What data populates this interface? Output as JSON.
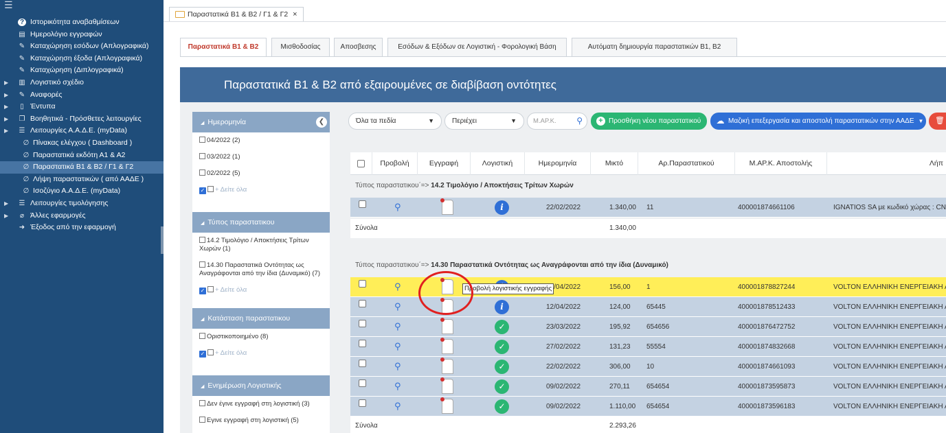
{
  "sidebar": {
    "items": [
      {
        "label": "Ιστορικότητα αναβαθμίσεων",
        "icon": "question-circle-icon",
        "level": "top",
        "arrow": ""
      },
      {
        "label": "Ημερολόγιο εγγραφών",
        "icon": "calendar-icon",
        "level": "top",
        "arrow": ""
      },
      {
        "label": "Καταχώρηση εσόδων (Απλογραφικά)",
        "icon": "edit-icon",
        "level": "top",
        "arrow": ""
      },
      {
        "label": "Καταχώρηση έξοδα (Απλογραφικά)",
        "icon": "edit-icon",
        "level": "top",
        "arrow": ""
      },
      {
        "label": "Καταχώρηση (Διπλογραφικά)",
        "icon": "edit-icon",
        "level": "top",
        "arrow": ""
      },
      {
        "label": "Λογιστικό σχέδιο",
        "icon": "book-icon",
        "level": "top",
        "arrow": "▶"
      },
      {
        "label": "Αναφορές",
        "icon": "edit-icon",
        "level": "top",
        "arrow": "▶"
      },
      {
        "label": "Έντυπα",
        "icon": "file-icon",
        "level": "top",
        "arrow": "▶"
      },
      {
        "label": "Βοηθητικά - Πρόσθετες λειτουργίες",
        "icon": "copy-icon",
        "level": "top",
        "arrow": "▶"
      },
      {
        "label": "Λειτουργίες Α.Α.Δ.Ε. (myData)",
        "icon": "list-icon",
        "level": "top",
        "arrow": "▶"
      },
      {
        "label": "Πίνακας ελέγχου ( Dashboard )",
        "icon": "link-icon",
        "level": "sub",
        "arrow": ""
      },
      {
        "label": "Παραστατικά εκδότη Α1 & Α2",
        "icon": "link-icon",
        "level": "sub",
        "arrow": ""
      },
      {
        "label": "Παραστατικά Β1 & Β2 / Γ1 & Γ2",
        "icon": "link-icon",
        "level": "sub",
        "arrow": "",
        "active": true
      },
      {
        "label": "Λήψη παραστατικών ( από ΑΑΔΕ )",
        "icon": "link-icon",
        "level": "sub",
        "arrow": ""
      },
      {
        "label": "Ισοζύγιο Α.Α.Δ.Ε. (myData)",
        "icon": "link-icon",
        "level": "sub",
        "arrow": ""
      },
      {
        "label": "Λειτουργίες τιμολόγησης",
        "icon": "list-icon",
        "level": "top",
        "arrow": "▶"
      },
      {
        "label": "Άλλες εφαρμογές",
        "icon": "paperclip-icon",
        "level": "top",
        "arrow": "▶"
      },
      {
        "label": "Έξοδος από την εφαρμογή",
        "icon": "logout-icon",
        "level": "top",
        "arrow": ""
      }
    ]
  },
  "doc_tab": {
    "label": "Παραστατικά Β1 & Β2 / Γ1 & Γ2",
    "close": "×"
  },
  "subtabs": [
    {
      "label": "Παραστατικά Β1 & Β2",
      "active": true
    },
    {
      "label": "Μισθοδοσίας"
    },
    {
      "label": "Αποσβεσης"
    },
    {
      "label": "Εσόδων & Εξόδων σε Λογιστική - Φορολογική Βάση"
    },
    {
      "label": "Αυτόματη δημιουργία παραστατικών Β1, Β2"
    }
  ],
  "panel": {
    "title": "Παραστατικά Β1 & Β2 από εξαιρουμένες σε διαβίβαση οντότητες"
  },
  "filters": {
    "see_all": "+ Δείτε όλα",
    "groups": [
      {
        "title": "Ημερομηνία",
        "items": [
          "04/2022 (2)",
          "03/2022 (1)",
          "02/2022 (5)"
        ]
      },
      {
        "title": "Τύπος παραστατικου",
        "items": [
          "14.2 Τιμολόγιο / Αποκτήσεις Τρίτων Χωρών (1)",
          "14.30 Παραστατικά Οντότητας ως Αναγράφονται από την ίδια (Δυναμικό) (7)"
        ]
      },
      {
        "title": "Κατάσταση παραστατικου",
        "items": [
          "Οριστικοποιημένο (8)"
        ]
      },
      {
        "title": "Ενημέρωση Λογιστικής",
        "items": [
          "Δεν έγινε εγγραφή στη λογιστική (3)",
          "Εγινε εγγραφή στη λογιστική (5)"
        ]
      }
    ]
  },
  "toolbar": {
    "field_select": "Όλα τα πεδία",
    "op_select": "Περιέχει",
    "marc_placeholder": "Μ.ΑΡ.Κ.",
    "add_label": "Προσθήκη νέου παραστατικού",
    "bulk_label": "Μαζική επεξεργασία και αποστολή παραστατικών στην ΑΑΔΕ"
  },
  "table": {
    "headers": [
      "Προβολή",
      "Εγγραφή",
      "Λογιστική",
      "Ημερομηνία",
      "Μικτό",
      "Αρ.Παραστατικού",
      "Μ.ΑΡ.Κ. Αποστολής",
      "Λήπ"
    ],
    "group1": {
      "prefix": "Τύπος παραστατικου΄=>",
      "name": "14.2 Τιμολόγιο / Αποκτήσεις Τρίτων Χωρών"
    },
    "group1_rows": [
      {
        "status": "info",
        "date": "22/02/2022",
        "gross": "1.340,00",
        "num": "11",
        "marc": "400001874661106",
        "recipient": "IGNATIOS SA με κωδικό χώρας : CN"
      }
    ],
    "group1_total": {
      "label": "Σύνολα",
      "value": "1.340,00"
    },
    "group2": {
      "prefix": "Τύπος παραστατικου΄=>",
      "name": "14.30 Παραστατικά Οντότητας ως Αναγράφονται από την ίδια (Δυναμικό)"
    },
    "group2_rows": [
      {
        "status": "info",
        "date": "13/04/2022",
        "gross": "156,00",
        "num": "1",
        "marc": "400001878827244",
        "recipient": "VOLTON ΕΛΛΗΝΙΚΗ ΕΝΕΡΓΕΙΑΚΗ ΑΝ",
        "highlight": true
      },
      {
        "status": "info",
        "date": "12/04/2022",
        "gross": "124,00",
        "num": "65445",
        "marc": "400001878512433",
        "recipient": "VOLTON ΕΛΛΗΝΙΚΗ ΕΝΕΡΓΕΙΑΚΗ ΑΝ"
      },
      {
        "status": "ok",
        "date": "23/03/2022",
        "gross": "195,92",
        "num": "654656",
        "marc": "400001876472752",
        "recipient": "VOLTON ΕΛΛΗΝΙΚΗ ΕΝΕΡΓΕΙΑΚΗ ΑΝ"
      },
      {
        "status": "ok",
        "date": "27/02/2022",
        "gross": "131,23",
        "num": "55554",
        "marc": "400001874832668",
        "recipient": "VOLTON ΕΛΛΗΝΙΚΗ ΕΝΕΡΓΕΙΑΚΗ ΑΝ"
      },
      {
        "status": "ok",
        "date": "22/02/2022",
        "gross": "306,00",
        "num": "10",
        "marc": "400001874661093",
        "recipient": "VOLTON ΕΛΛΗΝΙΚΗ ΕΝΕΡΓΕΙΑΚΗ ΑΝ"
      },
      {
        "status": "ok",
        "date": "09/02/2022",
        "gross": "270,11",
        "num": "654654",
        "marc": "400001873595873",
        "recipient": "VOLTON ΕΛΛΗΝΙΚΗ ΕΝΕΡΓΕΙΑΚΗ ΑΝ"
      },
      {
        "status": "ok",
        "date": "09/02/2022",
        "gross": "1.110,00",
        "num": "654654",
        "marc": "400001873596183",
        "recipient": "VOLTON ΕΛΛΗΝΙΚΗ ΕΝΕΡΓΕΙΑΚΗ ΑΝ"
      }
    ],
    "group2_total": {
      "label": "Σύνολα",
      "value": "2.293,26"
    }
  },
  "tooltip": "Προβολή λογιστικής εγγραφής",
  "colors": {
    "sidebar": "#1f4d7a",
    "panel_header": "#3f6a9a",
    "add_button": "#2bb673",
    "bulk_button": "#2f6fd6",
    "delete_button": "#e74c3c",
    "highlight_row": "#ffee58"
  }
}
